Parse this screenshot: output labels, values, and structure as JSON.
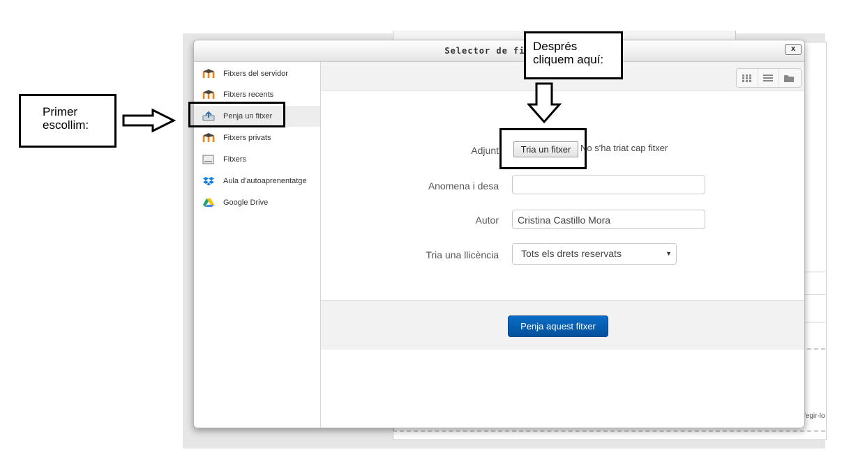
{
  "dialog": {
    "title": "Selector de fitxers",
    "close_label": "x"
  },
  "sidebar": {
    "items": [
      {
        "label": "Fitxers del servidor",
        "icon": "moodle-icon"
      },
      {
        "label": "Fitxers recents",
        "icon": "moodle-icon"
      },
      {
        "label": "Penja un fitxer",
        "icon": "upload-icon",
        "active": true
      },
      {
        "label": "Fitxers privats",
        "icon": "moodle-icon"
      },
      {
        "label": "Fitxers",
        "icon": "folder-icon"
      },
      {
        "label": "Aula d'autoaprenentatge",
        "icon": "dropbox-icon"
      },
      {
        "label": "Google Drive",
        "icon": "google-drive-icon"
      }
    ]
  },
  "view_buttons": [
    "grid-view-icon",
    "list-view-icon",
    "folder-view-icon"
  ],
  "form": {
    "attachment_label": "Adjunt",
    "choose_file_label": "Tria un fitxer",
    "no_file_text": "No s'ha triat cap fitxer",
    "save_as_label": "Anomena i desa",
    "save_as_value": "",
    "author_label": "Autor",
    "author_value": "Cristina Castillo Mora",
    "license_label": "Tria una llicència",
    "license_value": "Tots els drets reservats",
    "upload_button": "Penja aquest fitxer"
  },
  "annotations": {
    "first_line1": "Primer",
    "first_line2": "escollim:",
    "then_line1": "Després",
    "then_line2": "cliquem aquí:"
  },
  "background": {
    "cut_text": "fegir-lo"
  },
  "colors": {
    "primary_button": "#0a5fb4",
    "moodle_orange": "#f98012"
  }
}
